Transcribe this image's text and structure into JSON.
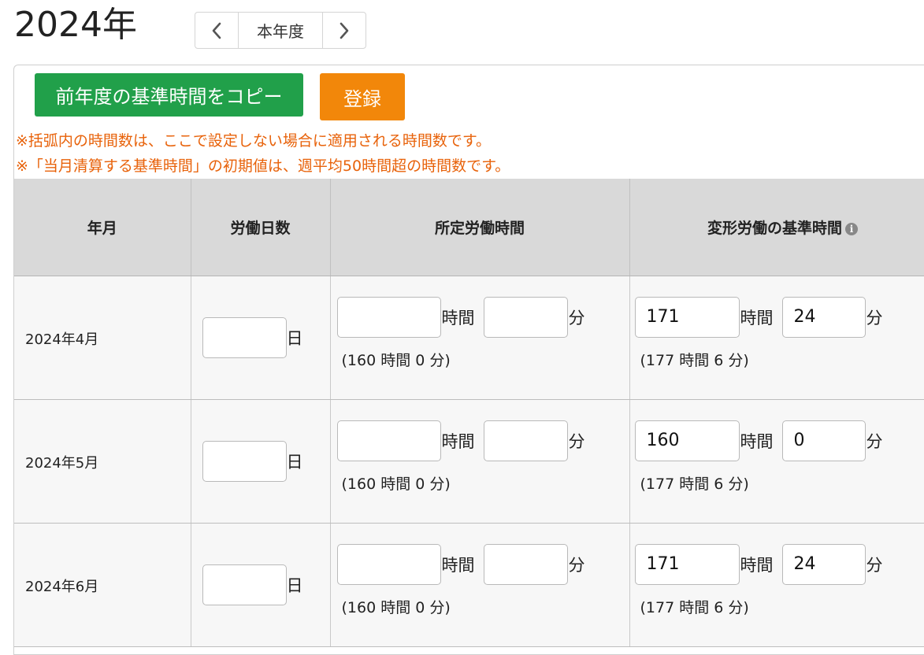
{
  "header": {
    "year_title": "2024年",
    "nav": {
      "prev_icon": "chevron-left-icon",
      "current_label": "本年度",
      "next_icon": "chevron-right-icon"
    }
  },
  "toolbar": {
    "copy_label": "前年度の基準時間をコピー",
    "register_label": "登録",
    "copy_color": "#21a04a",
    "register_color": "#f2870a"
  },
  "notes": [
    "※括弧内の時間数は、ここで設定しない場合に適用される時間数です。",
    "※「当月清算する基準時間」の初期値は、週平均50時間超の時間数です。"
  ],
  "note_color": "#e8620a",
  "table": {
    "headers": [
      "年月",
      "労働日数",
      "所定労働時間",
      "変形労働の基準時間"
    ],
    "info_icon": "info-icon",
    "units": {
      "day": "日",
      "hour": "時間",
      "minute": "分"
    },
    "rows": [
      {
        "month": "2024年4月",
        "days": "",
        "scheduled_hours": "",
        "scheduled_minutes": "",
        "scheduled_default": "(160 時間 0 分)",
        "variable_hours": "171",
        "variable_minutes": "24",
        "variable_default": "(177 時間 6 分)"
      },
      {
        "month": "2024年5月",
        "days": "",
        "scheduled_hours": "",
        "scheduled_minutes": "",
        "scheduled_default": "(160 時間 0 分)",
        "variable_hours": "160",
        "variable_minutes": "0",
        "variable_default": "(177 時間 6 分)"
      },
      {
        "month": "2024年6月",
        "days": "",
        "scheduled_hours": "",
        "scheduled_minutes": "",
        "scheduled_default": "(160 時間 0 分)",
        "variable_hours": "171",
        "variable_minutes": "24",
        "variable_default": "(177 時間 6 分)"
      }
    ]
  }
}
